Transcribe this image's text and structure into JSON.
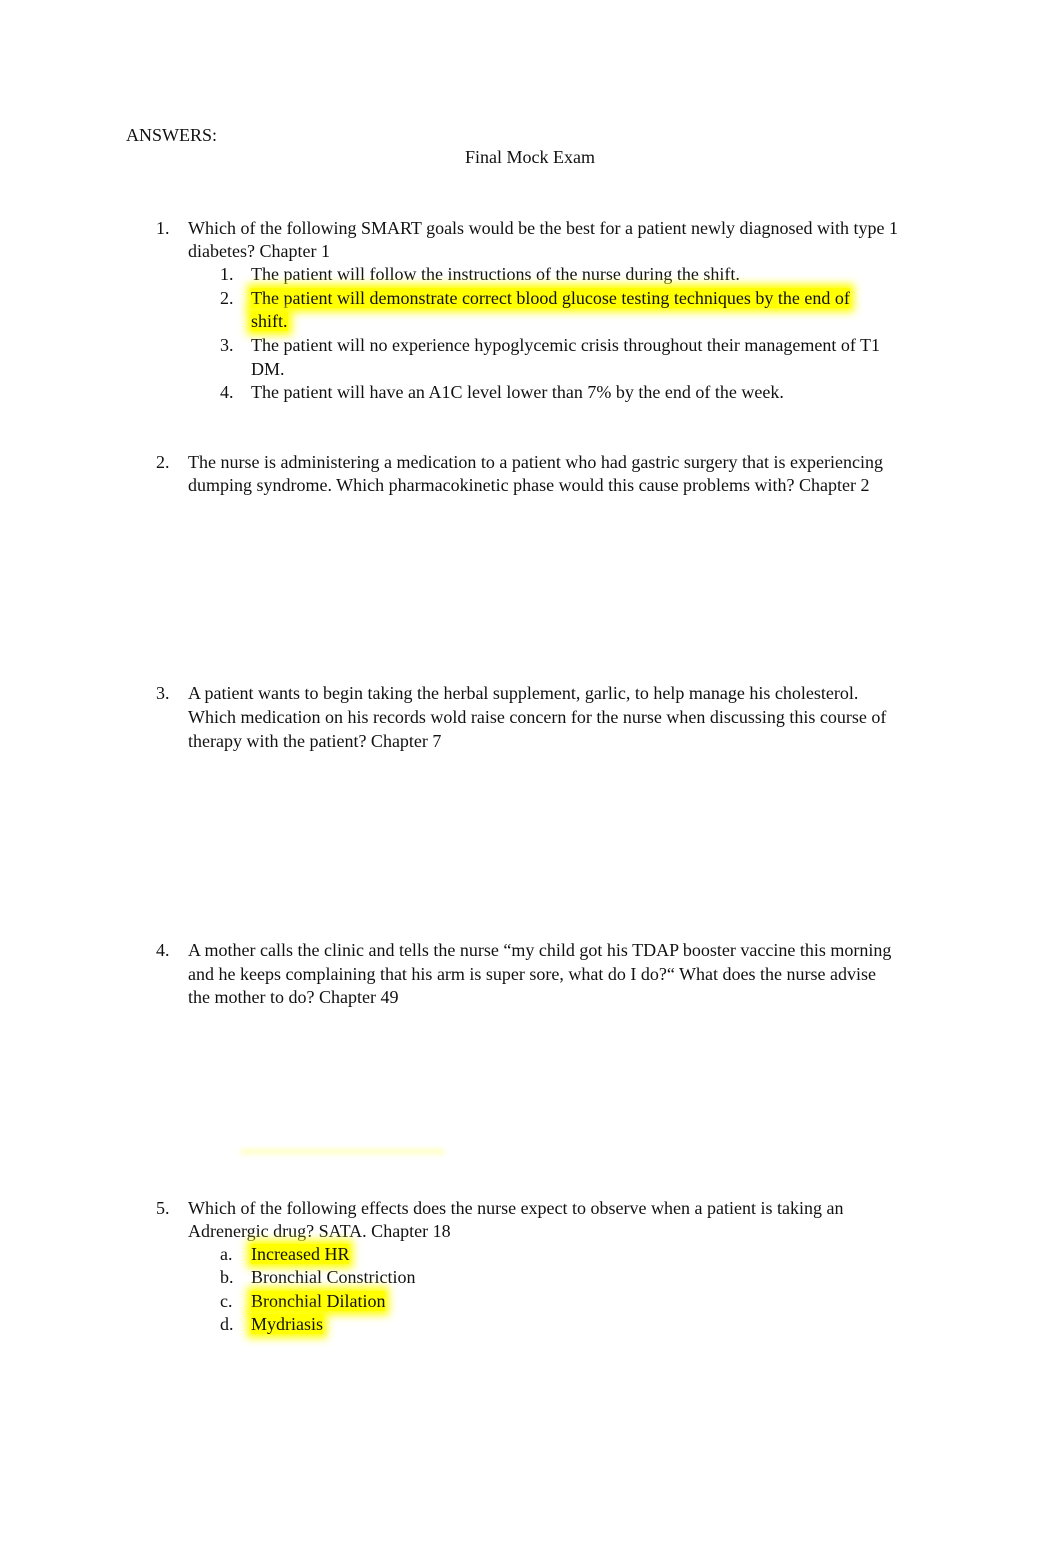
{
  "header": {
    "answers_label": "ANSWERS:",
    "title": "Final Mock Exam"
  },
  "highlight_color": "#ffff00",
  "questions": [
    {
      "number": "1.",
      "lines": [
        "Which of the following SMART goals would be the best for a patient newly diagnosed with type 1",
        "diabetes? Chapter 1"
      ],
      "options": [
        {
          "marker": "1.",
          "lines": [
            "The patient will follow the instructions of the nurse during the shift."
          ],
          "highlighted": false
        },
        {
          "marker": "2.",
          "lines": [
            "The patient will demonstrate correct blood glucose testing techniques by the end of",
            "shift."
          ],
          "highlighted": true
        },
        {
          "marker": "3.",
          "lines": [
            "The patient will no experience hypoglycemic crisis throughout their management of T1",
            "DM."
          ],
          "highlighted": false
        },
        {
          "marker": "4.",
          "lines": [
            "The patient will have an A1C level lower than 7% by the end of the week."
          ],
          "highlighted": false
        }
      ]
    },
    {
      "number": "2.",
      "lines": [
        "The nurse is administering a medication to a patient who had gastric surgery that is experiencing",
        "dumping syndrome. Which pharmacokinetic phase would this cause problems with? Chapter 2"
      ]
    },
    {
      "number": "3.",
      "lines": [
        "A patient wants to begin taking the herbal supplement, garlic, to help manage his cholesterol.",
        "Which medication on his records wold raise concern for the nurse when discussing this course of",
        "therapy with the patient? Chapter 7"
      ]
    },
    {
      "number": "4.",
      "lines": [
        "A mother calls the clinic and tells the nurse “my child got his TDAP booster vaccine this morning",
        "and he keeps complaining that his arm is super sore, what do I do?“ What does the nurse advise",
        "the mother to do? Chapter 49"
      ]
    },
    {
      "number": "5.",
      "lines": [
        "Which of the following effects does the nurse expect to observe when a patient is taking an",
        "Adrenergic drug? SATA. Chapter 18"
      ],
      "options": [
        {
          "marker": "a.",
          "lines": [
            "Increased HR"
          ],
          "highlighted": true
        },
        {
          "marker": "b.",
          "lines": [
            "Bronchial Constriction"
          ],
          "highlighted": false
        },
        {
          "marker": "c.",
          "lines": [
            "Bronchial Dilation"
          ],
          "highlighted": true
        },
        {
          "marker": "d.",
          "lines": [
            "Mydriasis"
          ],
          "highlighted": true
        }
      ]
    }
  ]
}
